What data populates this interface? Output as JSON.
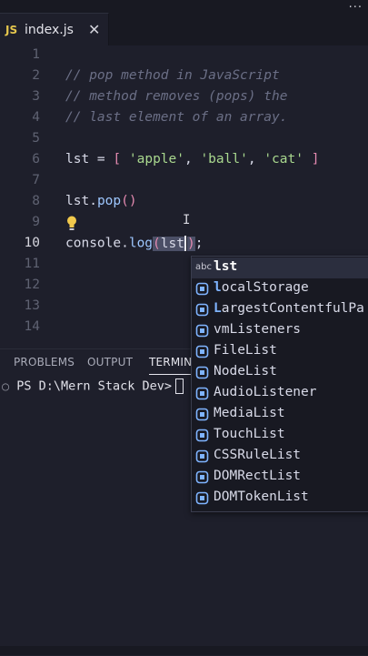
{
  "topbar": {
    "menu_glyph": "..."
  },
  "tab": {
    "badge": "JS",
    "filename": "index.js",
    "close_glyph": "✕"
  },
  "editor": {
    "lines": [
      {
        "num": "1"
      },
      {
        "num": "2",
        "comment": "// pop method in JavaScript"
      },
      {
        "num": "3",
        "comment": "// method removes (pops) the"
      },
      {
        "num": "4",
        "comment": "// last element of an array."
      },
      {
        "num": "5"
      },
      {
        "num": "6"
      },
      {
        "num": "7"
      },
      {
        "num": "8"
      },
      {
        "num": "9"
      },
      {
        "num": "10"
      },
      {
        "num": "11"
      },
      {
        "num": "12"
      },
      {
        "num": "13"
      },
      {
        "num": "14"
      }
    ],
    "line6": {
      "var": "lst",
      "eq": " = ",
      "lb": "[",
      "s1": "'apple'",
      "c1": ", ",
      "s2": "'ball'",
      "c2": ", ",
      "s3": "'cat'",
      "rb": "]"
    },
    "line8": {
      "obj": "lst",
      "dot": ".",
      "fn": "pop",
      "paren": "()"
    },
    "line10": {
      "obj": "console",
      "dot": ".",
      "fn": "log",
      "lp": "(",
      "arg": "lst",
      "rp": ")",
      "semi": ";"
    }
  },
  "panel": {
    "tabs": [
      "PROBLEMS",
      "OUTPUT",
      "TERMINAL"
    ],
    "prompt": "PS D:\\Mern Stack Dev>"
  },
  "suggestions": [
    {
      "match": "lst",
      "rest": "",
      "icon": "text-abc-icon",
      "selected": true
    },
    {
      "match": "l",
      "rest": "ocalStorage",
      "icon": "variable-icon"
    },
    {
      "match": "L",
      "rest": "argestContentfulPa",
      "icon": "variable-icon"
    },
    {
      "match": "",
      "rest": "vmListeners",
      "icon": "variable-icon"
    },
    {
      "match": "",
      "rest": "FileList",
      "icon": "variable-icon"
    },
    {
      "match": "",
      "rest": "NodeList",
      "icon": "variable-icon"
    },
    {
      "match": "",
      "rest": "AudioListener",
      "icon": "variable-icon"
    },
    {
      "match": "",
      "rest": "MediaList",
      "icon": "variable-icon"
    },
    {
      "match": "",
      "rest": "TouchList",
      "icon": "variable-icon"
    },
    {
      "match": "",
      "rest": "CSSRuleList",
      "icon": "variable-icon"
    },
    {
      "match": "",
      "rest": "DOMRectList",
      "icon": "variable-icon"
    },
    {
      "match": "",
      "rest": "DOMTokenList",
      "icon": "variable-icon"
    }
  ],
  "suggest_abc": "abc",
  "colors": {
    "accent": "#7fb4ff",
    "string": "#a9d88e",
    "comment": "#6b6f86",
    "bracket": "#e48ab0",
    "js_badge": "#e5c64d"
  }
}
